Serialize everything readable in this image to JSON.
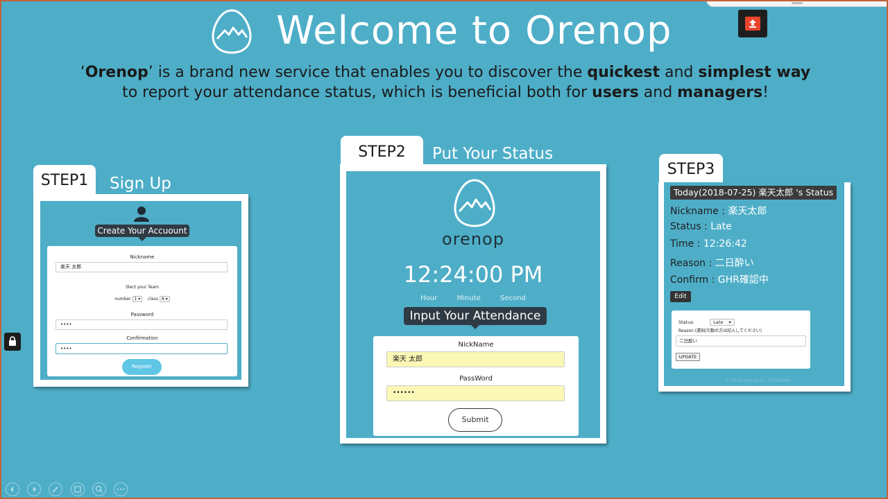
{
  "header": {
    "title": "Welcome to Orenop",
    "intro": {
      "line1": [
        {
          "t": "‘",
          "b": false
        },
        {
          "t": "Orenop",
          "b": true
        },
        {
          "t": "’ is a brand new service that enables you to discover the ",
          "b": false
        },
        {
          "t": "quickest",
          "b": true
        },
        {
          "t": " and ",
          "b": false
        },
        {
          "t": "simplest way",
          "b": true
        }
      ],
      "line2": [
        {
          "t": "to report your attendance status, which is beneficial both for ",
          "b": false
        },
        {
          "t": "users",
          "b": true
        },
        {
          "t": " and ",
          "b": false
        },
        {
          "t": "managers",
          "b": true
        },
        {
          "t": "!",
          "b": false
        }
      ]
    }
  },
  "step1": {
    "tab": "STEP1",
    "caption": "Sign Up",
    "tooltip": "Create Your Accuount",
    "nickname_label": "Nickname",
    "nickname_value": "楽天 太郎",
    "team_label": "Slect your Team",
    "number_label": "number",
    "number_value": "1",
    "class_label": "class",
    "class_value": "A",
    "password_label": "Password",
    "password_value": "••••",
    "confirm_label": "Confirmation",
    "confirm_value": "••••",
    "register_label": "Register"
  },
  "step2": {
    "tab": "STEP2",
    "caption": "Put Your Status",
    "brand": "orenop",
    "clock": "12:24:00 PM",
    "clock_labels": [
      "Hour",
      "Minute",
      "Second"
    ],
    "tooltip": "Input Your Attendance",
    "nick_label": "NickName",
    "nick_value": "楽天 太郎",
    "pass_label": "PassWord",
    "pass_value": "••••••",
    "submit_label": "Submit"
  },
  "step3": {
    "tab": "STEP3",
    "status_title": "Today(2018-07-25) 楽天太郎 's Status",
    "rows": [
      {
        "key": "Nickname : ",
        "value": "楽天太郎"
      },
      {
        "key": "Status : ",
        "value": "Late"
      },
      {
        "key": "Time : ",
        "value": "12:26:42"
      },
      {
        "key": "Reason : ",
        "value": "二日酔い"
      },
      {
        "key": "Confirm : ",
        "value": "GHR確認中"
      }
    ],
    "edit_label": "Edit",
    "status_label": "Status:",
    "status_value": "Late",
    "reason_label": "Reason",
    "reason_hint": "(遅刻/欠勤の方は記入してください)",
    "reason_value": "二日酔い",
    "update_label": "UPDATE",
    "footer": "© 2018 orenop inc. EDTASGMa"
  },
  "icons": {
    "share": "share-icon",
    "lock": "lock-icon",
    "user": "user-icon",
    "logo": "orenop-egg-logo-icon",
    "nav": [
      "prev-icon",
      "next-icon",
      "pen-icon",
      "slides-icon",
      "zoom-icon",
      "more-icon"
    ]
  },
  "colors": {
    "background": "#4eaec8",
    "accent": "#e9452c",
    "tooltip": "#2f3b44",
    "input_fill": "#fbf7b5"
  }
}
